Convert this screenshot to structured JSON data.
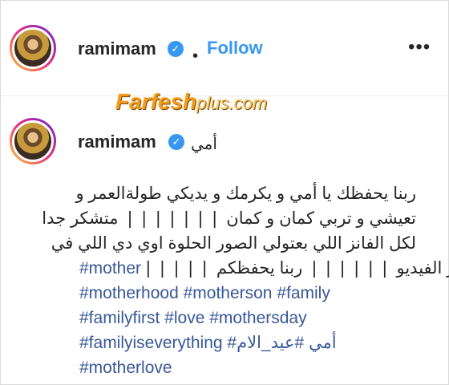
{
  "post": {
    "username": "ramimam",
    "verified_symbol": "✓",
    "separator": "•",
    "follow_label": "Follow",
    "more_label": "•••"
  },
  "watermark": {
    "brand": "Farfesh",
    "sub": "plus.com"
  },
  "caption": {
    "username": "ramimam",
    "title": "أمي",
    "lines": [
      "ربنا يحفظك يا أمي و يكرمك و يديكي طولةالعمر و",
      "تعيشي و تربي كمان و كمان ❘❘❘❘❘❘❘ متشكر جدا",
      "لكل الفانز اللي بعتولي الصور الحلوة اوي دي اللي في",
      "اخر الفيديو ❘❘❘❘❘❘ ربنا يحفظكم ❘❘❘❘❘"
    ],
    "tag_mother": "#mother",
    "hashtags_line2": "#motherhood #motherson #family",
    "hashtags_line3": "#familyfirst #love #mothersday",
    "hashtags_line4_a": "#familyiseverything #أمي #",
    "hashtags_line4_b": "عيد_الام",
    "hashtags_line5": "#motherlove"
  },
  "colors": {
    "link": "#3897f0",
    "hashtag": "#385898",
    "watermark": "#f29b1d"
  }
}
